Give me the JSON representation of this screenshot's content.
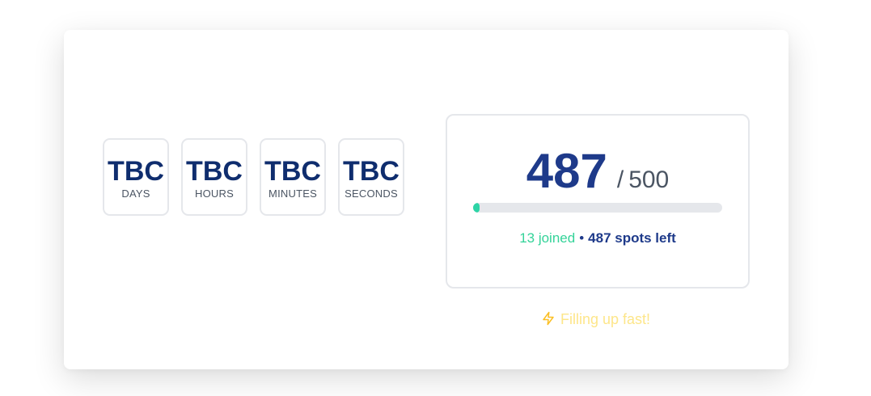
{
  "countdown": [
    {
      "value": "TBC",
      "label": "DAYS"
    },
    {
      "value": "TBC",
      "label": "HOURS"
    },
    {
      "value": "TBC",
      "label": "MINUTES"
    },
    {
      "value": "TBC",
      "label": "SECONDS"
    }
  ],
  "spots": {
    "count": "487",
    "separator": "/",
    "total": "500",
    "progress_fraction": 0.026,
    "joined_text": "13 joined",
    "bullet": "•",
    "spots_left_text": "487 spots left"
  },
  "hint": {
    "icon": "lightning-icon",
    "text": "Filling up fast!"
  },
  "colors": {
    "primary": "#1e3a8a",
    "joined": "#34d399",
    "hint": "#fde68a"
  }
}
